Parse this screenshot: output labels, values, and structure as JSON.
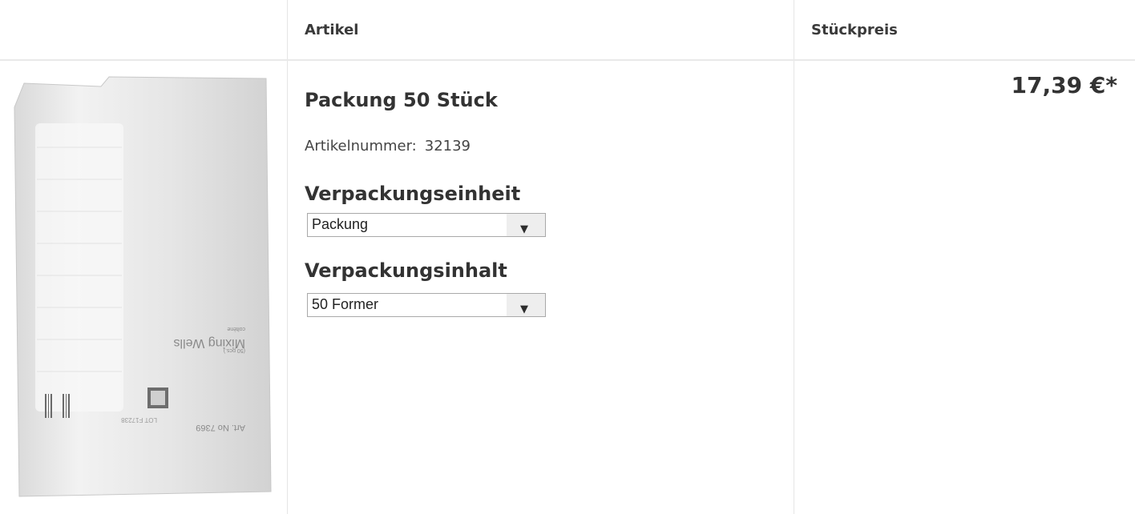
{
  "header": {
    "col_article": "Artikel",
    "col_unit_price": "Stückpreis"
  },
  "product": {
    "image_alt": "Mixing Wells pack",
    "image_print": {
      "brand": "coltène",
      "name": "Mixing Wells",
      "qty": "(50 pcs.)",
      "art_no": "Art. No 7369",
      "code": "LOT F17238"
    },
    "title": "Packung 50 Stück",
    "artno_label": "Artikelnummer:",
    "artno_value": "32139",
    "unit_label": "Verpackungseinheit",
    "unit_value": "Packung",
    "content_label": "Verpackungsinhalt",
    "content_value": "50 Former",
    "price": "17,39 €*"
  },
  "icons": {
    "dropdown": "triangle-down-icon"
  }
}
